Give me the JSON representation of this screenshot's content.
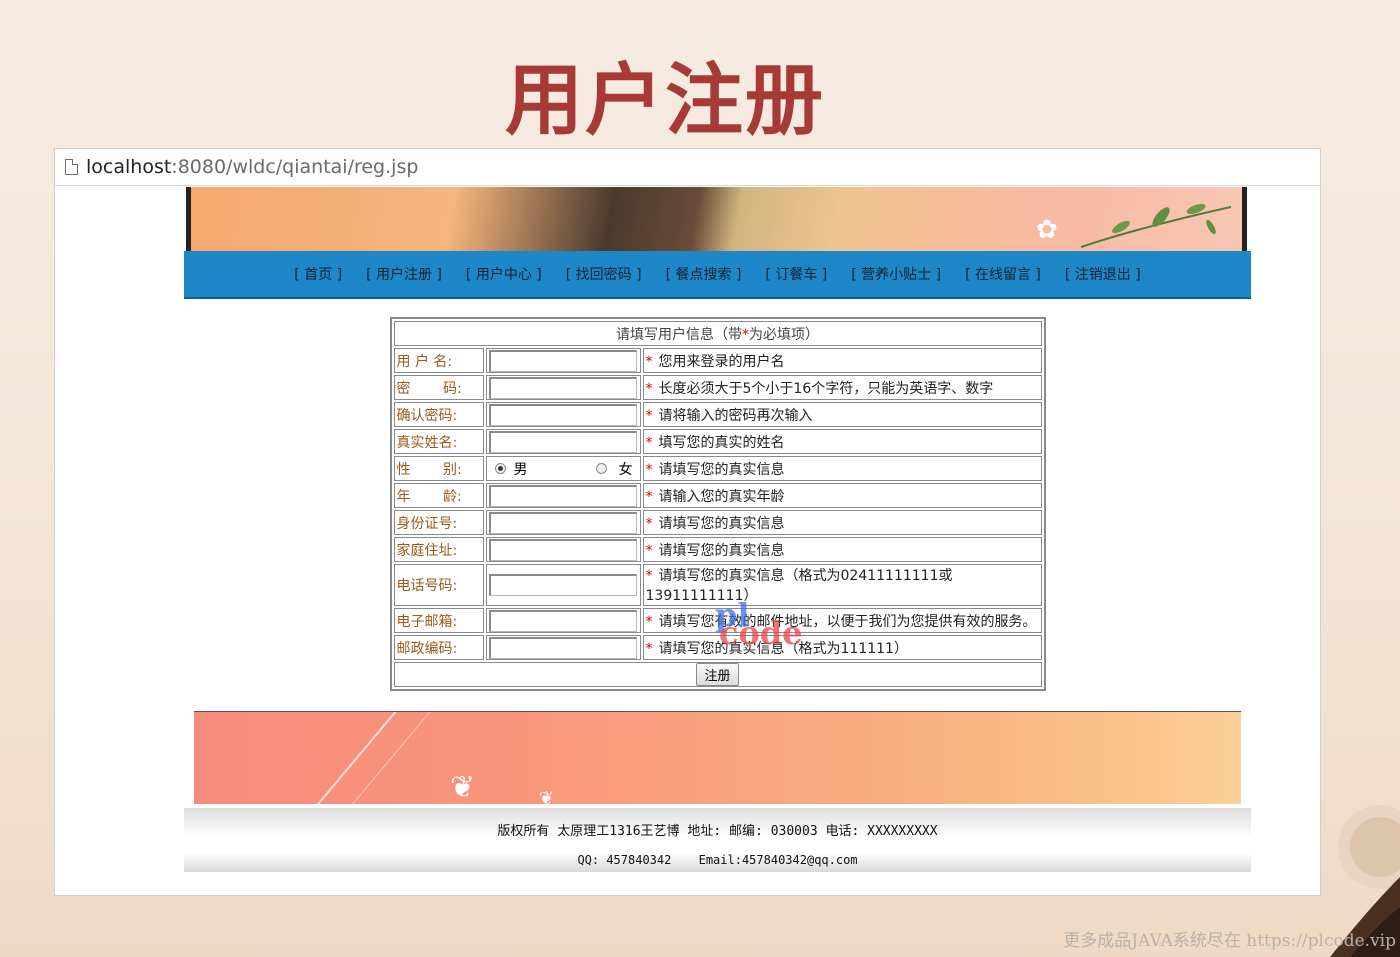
{
  "slide": {
    "title": "用户注册"
  },
  "browser": {
    "url_host": "localhost",
    "url_rest": ":8080/wldc/qiantai/reg.jsp"
  },
  "nav": {
    "items": [
      {
        "label": "[ 首页 ]"
      },
      {
        "label": "[ 用户注册 ]"
      },
      {
        "label": "[ 用户中心 ]"
      },
      {
        "label": "[ 找回密码 ]"
      },
      {
        "label": "[ 餐点搜索 ]"
      },
      {
        "label": "[ 订餐车 ]"
      },
      {
        "label": "[ 营养小贴士 ]"
      },
      {
        "label": "[ 在线留言 ]"
      },
      {
        "label": "[ 注销退出 ]"
      }
    ]
  },
  "form": {
    "caption_before": "请填写用户信息（带",
    "caption_star": "*",
    "caption_after": "为必填项）",
    "required_mark": "*",
    "rows": [
      {
        "label": "用 户 名:",
        "value": "",
        "hint": "您用来登录的用户名"
      },
      {
        "label": "密　　 码:",
        "value": "",
        "hint": "长度必须大于5个小于16个字符，只能为英语字、数字"
      },
      {
        "label": "确认密码:",
        "value": "",
        "hint": "请将输入的密码再次输入"
      },
      {
        "label": "真实姓名:",
        "value": "",
        "hint": "填写您的真实的姓名"
      },
      {
        "label": "性　　 别:",
        "hint": "请填写您的真实信息"
      },
      {
        "label": "年　　 龄:",
        "value": "",
        "hint": "请输入您的真实年龄"
      },
      {
        "label": "身份证号:",
        "value": "",
        "hint": "请填写您的真实信息"
      },
      {
        "label": "家庭住址:",
        "value": "",
        "hint": "请填写您的真实信息"
      },
      {
        "label": "电话号码:",
        "value": "",
        "hint": "请填写您的真实信息（格式为02411111111或13911111111）"
      },
      {
        "label": "电子邮箱:",
        "value": "",
        "hint": "请填写您有效的邮件地址，以便于我们为您提供有效的服务。"
      },
      {
        "label": "邮政编码:",
        "value": "",
        "hint": "请填写您的真实信息（格式为111111）"
      }
    ],
    "gender": {
      "male": "男",
      "female": "女",
      "selected": "男"
    },
    "submit_label": "注册"
  },
  "footer": {
    "line1": "版权所有 太原理工1316王艺博 地址: 邮编: 030003 电话: XXXXXXXXX",
    "qq": "QQ: 457840342",
    "email": "Email:457840342@qq.com"
  },
  "watermarks": {
    "logo_top": "pl",
    "logo_bottom": "code",
    "bottom_text": "更多成品JAVA系统尽在 https://plcode.vip"
  }
}
